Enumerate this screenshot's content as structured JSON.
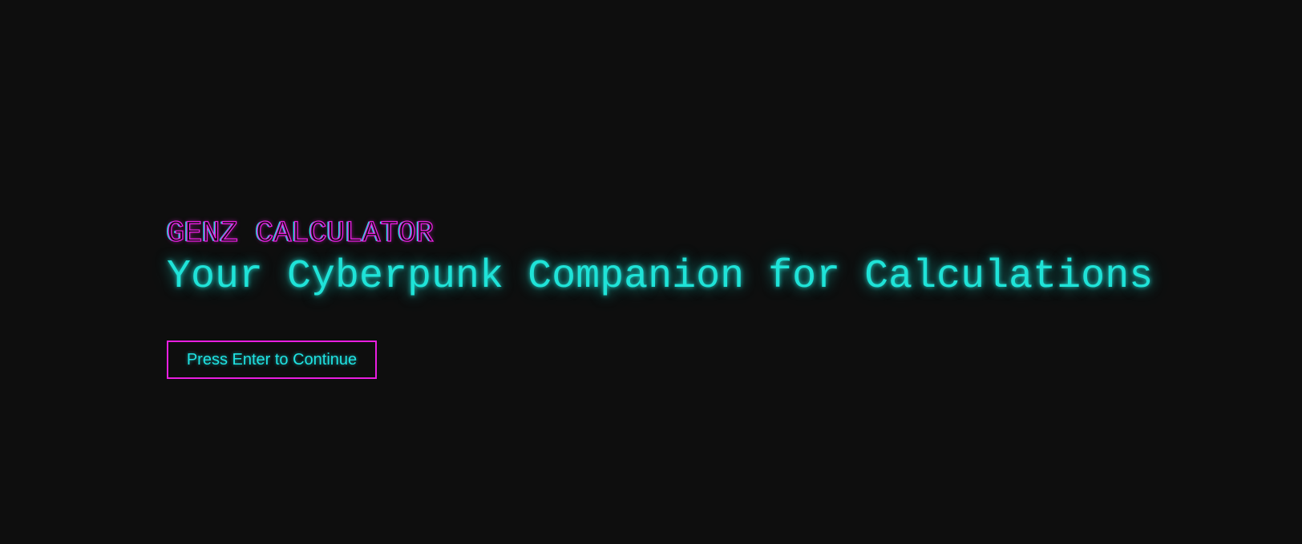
{
  "splash": {
    "title": "GENZ CALCULATOR",
    "tagline": "Your Cyberpunk Companion for Calculations",
    "continue_label": "Press Enter to Continue"
  },
  "colors": {
    "background": "#0e0e0e",
    "accent_magenta": "#e81ee0",
    "accent_cyan": "#1fe3d8"
  }
}
